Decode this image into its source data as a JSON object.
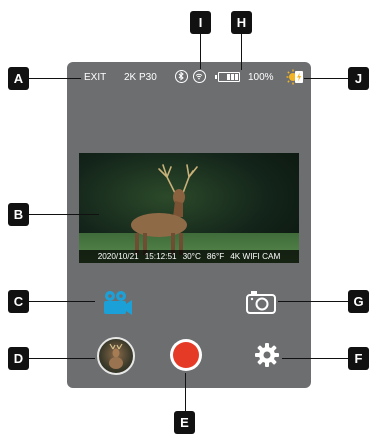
{
  "status_bar": {
    "exit_label": "EXIT",
    "resolution": "2K P30",
    "battery_percent": "100%"
  },
  "preview": {
    "date": "2020/10/21",
    "time": "15:12:51",
    "temp_c": "30°C",
    "temp_f": "86°F",
    "camera_name": "4K WIFI CAM"
  },
  "callouts": {
    "a": "A",
    "b": "B",
    "c": "C",
    "d": "D",
    "e": "E",
    "f": "F",
    "g": "G",
    "h": "H",
    "i": "I",
    "j": "J"
  },
  "colors": {
    "screen_bg": "#6d6e70",
    "video_icon": "#1ba1d8",
    "record": "#e53a26",
    "battery_charge": "#f2b424"
  },
  "icons": {
    "bluetooth": "bluetooth-icon",
    "wifi": "wifi-icon",
    "battery": "battery-icon",
    "charging": "solar-charging-icon",
    "video_mode": "video-camera-icon",
    "photo_mode": "photo-camera-icon",
    "record": "record-icon",
    "settings": "gear-icon",
    "gallery": "gallery-thumbnail"
  }
}
